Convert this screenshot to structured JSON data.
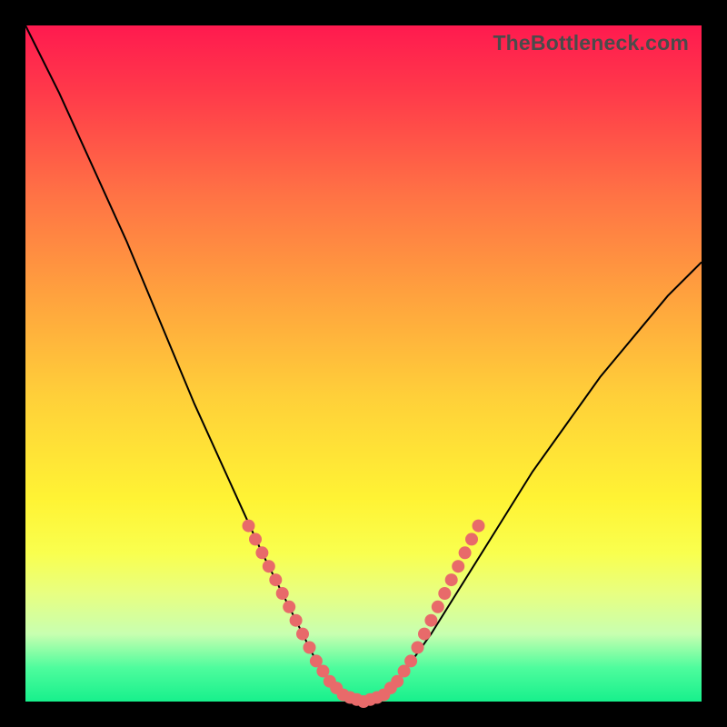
{
  "watermark": "TheBottleneck.com",
  "colors": {
    "frame": "#000000",
    "gradient_top": "#ff1a4f",
    "gradient_bottom": "#17f08c",
    "curve": "#000000",
    "dot": "#e86a6a"
  },
  "chart_data": {
    "type": "line",
    "title": "",
    "xlabel": "",
    "ylabel": "",
    "xlim": [
      0,
      100
    ],
    "ylim": [
      0,
      100
    ],
    "x": [
      0,
      5,
      10,
      15,
      20,
      25,
      30,
      35,
      40,
      43,
      45,
      47,
      49,
      50,
      51,
      53,
      55,
      60,
      65,
      70,
      75,
      80,
      85,
      90,
      95,
      100
    ],
    "y": [
      100,
      90,
      79,
      68,
      56,
      44,
      33,
      22,
      12,
      6,
      3,
      1,
      0.3,
      0,
      0.3,
      1,
      3,
      10,
      18,
      26,
      34,
      41,
      48,
      54,
      60,
      65
    ],
    "series": [
      {
        "name": "bottleneck-curve",
        "type": "line",
        "x": [
          0,
          5,
          10,
          15,
          20,
          25,
          30,
          35,
          40,
          43,
          45,
          47,
          49,
          50,
          51,
          53,
          55,
          60,
          65,
          70,
          75,
          80,
          85,
          90,
          95,
          100
        ],
        "y": [
          100,
          90,
          79,
          68,
          56,
          44,
          33,
          22,
          12,
          6,
          3,
          1,
          0.3,
          0,
          0.3,
          1,
          3,
          10,
          18,
          26,
          34,
          41,
          48,
          54,
          60,
          65
        ]
      },
      {
        "name": "left-cluster-dots",
        "type": "scatter",
        "x": [
          33,
          34,
          35,
          36,
          37,
          38,
          39,
          40,
          41,
          42,
          43,
          44,
          45,
          46,
          47,
          48,
          49,
          50,
          51,
          52
        ],
        "y": [
          26,
          24,
          22,
          20,
          18,
          16,
          14,
          12,
          10,
          8,
          6,
          4.5,
          3,
          2,
          1,
          0.6,
          0.3,
          0,
          0.3,
          0.6
        ]
      },
      {
        "name": "right-cluster-dots",
        "type": "scatter",
        "x": [
          53,
          54,
          55,
          56,
          57,
          58,
          59,
          60,
          61,
          62,
          63,
          64,
          65,
          66,
          67
        ],
        "y": [
          1,
          2,
          3,
          4.5,
          6,
          8,
          10,
          12,
          14,
          16,
          18,
          20,
          22,
          24,
          26
        ]
      }
    ]
  }
}
